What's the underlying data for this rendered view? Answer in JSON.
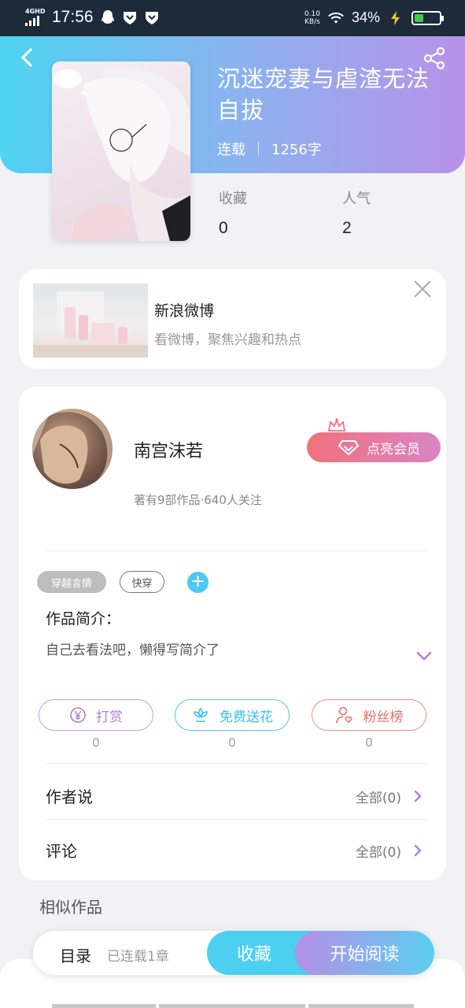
{
  "status_bar": {
    "network": "4G",
    "network_hd": "HD",
    "time": "17:56",
    "speed_value": "0.10",
    "speed_unit": "KB/s",
    "battery": "34%",
    "icons": [
      "qq-icon",
      "shield-heart-icon",
      "shield-heart-icon",
      "wifi-icon",
      "charging-icon",
      "battery-icon"
    ]
  },
  "header": {
    "title": "沉迷宠妻与虐渣无法自拔",
    "status": "连载",
    "word_count": "1256字",
    "stats": [
      {
        "label": "收藏",
        "value": "0"
      },
      {
        "label": "人气",
        "value": "2"
      }
    ]
  },
  "ad": {
    "title": "新浪微博",
    "subtitle": "看微博，聚焦兴趣和热点"
  },
  "author": {
    "name": "南宫沫若",
    "stats": "著有9部作品·640人关注",
    "vip_button": "点亮会员"
  },
  "tags": [
    "穿越言情",
    "快穿"
  ],
  "tag_add": "+",
  "intro": {
    "label": "作品简介：",
    "text": "自己去看法吧，懒得写简介了"
  },
  "actions": [
    {
      "label": "打赏",
      "count": "0",
      "icon": "yuan-coin-icon"
    },
    {
      "label": "免费送花",
      "count": "0",
      "icon": "flower-icon"
    },
    {
      "label": "粉丝榜",
      "count": "0",
      "icon": "fan-user-icon"
    }
  ],
  "rows": [
    {
      "label": "作者说",
      "value": "全部(0)"
    },
    {
      "label": "评论",
      "value": "全部(0)"
    }
  ],
  "similar_title": "相似作品",
  "bottom_bar": {
    "toc": "目录",
    "toc_sub": "已连载1章",
    "collect": "收藏",
    "read": "开始阅读"
  },
  "colors": {
    "header_gradient_start": "#4fd3f3",
    "header_gradient_end": "#b792e8",
    "accent_blue": "#4cc9ef",
    "accent_purple": "#b27fd6",
    "accent_red": "#e46f68"
  }
}
